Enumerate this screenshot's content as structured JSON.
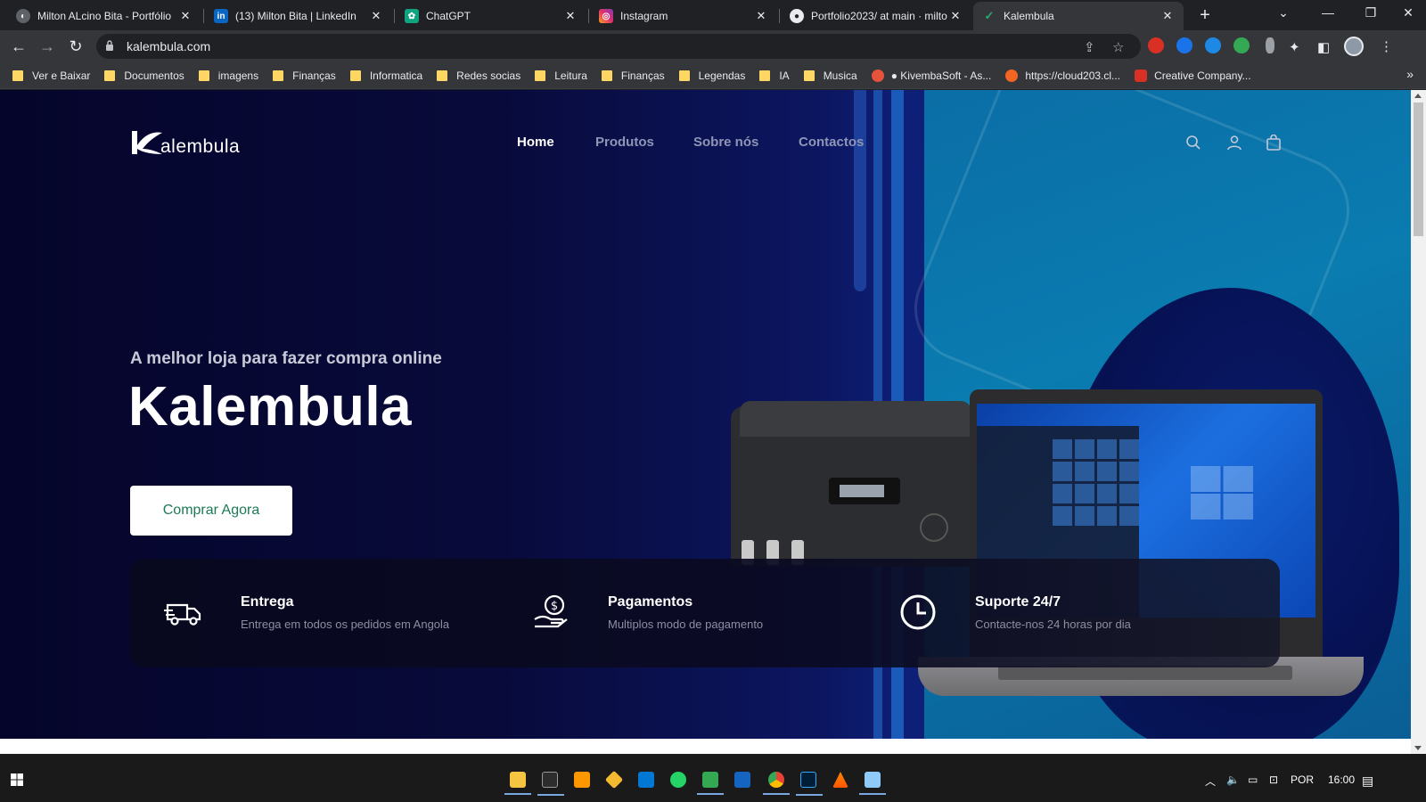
{
  "browser": {
    "tabs": [
      {
        "title": "Milton ALcino Bita - Portfólio",
        "favicon": "globe-icon",
        "color": "#8ab4f8"
      },
      {
        "title": "(13) Milton Bita | LinkedIn",
        "favicon": "linkedin-icon",
        "color": "#0a66c2"
      },
      {
        "title": "ChatGPT",
        "favicon": "chatgpt-icon",
        "color": "#10a37f"
      },
      {
        "title": "Instagram",
        "favicon": "instagram-icon",
        "color": "#e1306c"
      },
      {
        "title": "Portfolio2023/ at main · milto",
        "favicon": "github-icon",
        "color": "#e8eaed"
      },
      {
        "title": "Kalembula",
        "favicon": "kalembula-icon",
        "color": "#2ea86a"
      }
    ],
    "active_tab": 5,
    "url": "kalembula.com",
    "bookmarks": [
      {
        "label": "Ver e Baixar",
        "type": "folder"
      },
      {
        "label": "Documentos",
        "type": "folder"
      },
      {
        "label": "imagens",
        "type": "folder"
      },
      {
        "label": "Finanças",
        "type": "folder"
      },
      {
        "label": "Informatica",
        "type": "folder"
      },
      {
        "label": "Redes socias",
        "type": "folder"
      },
      {
        "label": "Leitura",
        "type": "folder"
      },
      {
        "label": "Finanças",
        "type": "folder"
      },
      {
        "label": "Legendas",
        "type": "folder"
      },
      {
        "label": "IA",
        "type": "folder"
      },
      {
        "label": "Musica",
        "type": "folder"
      },
      {
        "label": "● KivembaSoft - As...",
        "type": "site",
        "color": "#e5533d"
      },
      {
        "label": "https://cloud203.cl...",
        "type": "site",
        "color": "#f26522"
      },
      {
        "label": "Creative Company...",
        "type": "site",
        "color": "#d93025"
      }
    ]
  },
  "site": {
    "logo_text": "alembula",
    "nav": [
      "Home",
      "Produtos",
      "Sobre nós",
      "Contactos"
    ],
    "active_nav": 0,
    "tagline": "A melhor loja para fazer compra online",
    "brand": "Kalembula",
    "cta": "Comprar Agora",
    "features": [
      {
        "title": "Entrega",
        "desc": "Entrega em todos os pedidos em Angola",
        "icon": "delivery-truck-icon"
      },
      {
        "title": "Pagamentos",
        "desc": "Multiplos modo de pagamento",
        "icon": "payment-hand-icon"
      },
      {
        "title": "Suporte 24/7",
        "desc": "Contacte-nos 24 horas por dia",
        "icon": "clock-icon"
      }
    ],
    "colors": {
      "cta_text": "#1d7a56",
      "hero_dark": "#05052b",
      "hero_blue": "#0a7cb0"
    }
  },
  "taskbar": {
    "tray_lang": "POR",
    "tray_time": "16:00"
  }
}
